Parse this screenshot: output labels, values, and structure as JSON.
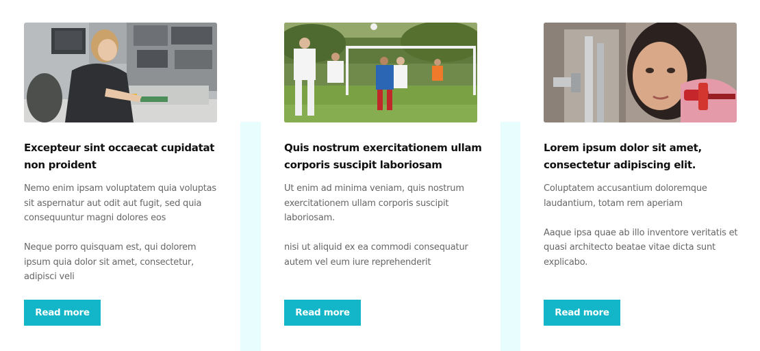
{
  "colors": {
    "accent": "#13b6c9",
    "band": "#e8fdfd",
    "title": "#111111",
    "body_text": "#666666"
  },
  "cards": [
    {
      "image": "woman-soldering-electronics-lab-photo",
      "title": "Excepteur sint occaecat cupidatat non proident",
      "paragraphs": [
        "Nemo enim ipsam voluptatem quia voluptas sit aspernatur aut odit aut fugit, sed quia consequuntur magni dolores eos",
        "Neque porro quisquam est, qui dolorem ipsum quia dolor sit amet, consectetur, adipisci veli"
      ],
      "button": "Read more"
    },
    {
      "image": "soccer-players-on-field-photo",
      "title": "Quis nostrum exercitationem ullam corporis suscipit laboriosam",
      "paragraphs": [
        "Ut enim ad minima veniam, quis nostrum exercitationem ullam corporis suscipit laboriosam.",
        "nisi ut aliquid ex ea commodi consequatur autem vel eum iure reprehenderit"
      ],
      "button": "Read more"
    },
    {
      "image": "woman-plumber-with-wrench-photo",
      "title": "Lorem ipsum dolor sit amet, consectetur adipiscing elit.",
      "paragraphs": [
        "Coluptatem accusantium doloremque laudantium, totam rem aperiam",
        "Aaque ipsa quae ab illo inventore veritatis et quasi architecto beatae vitae dicta sunt explicabo."
      ],
      "button": "Read more"
    }
  ]
}
